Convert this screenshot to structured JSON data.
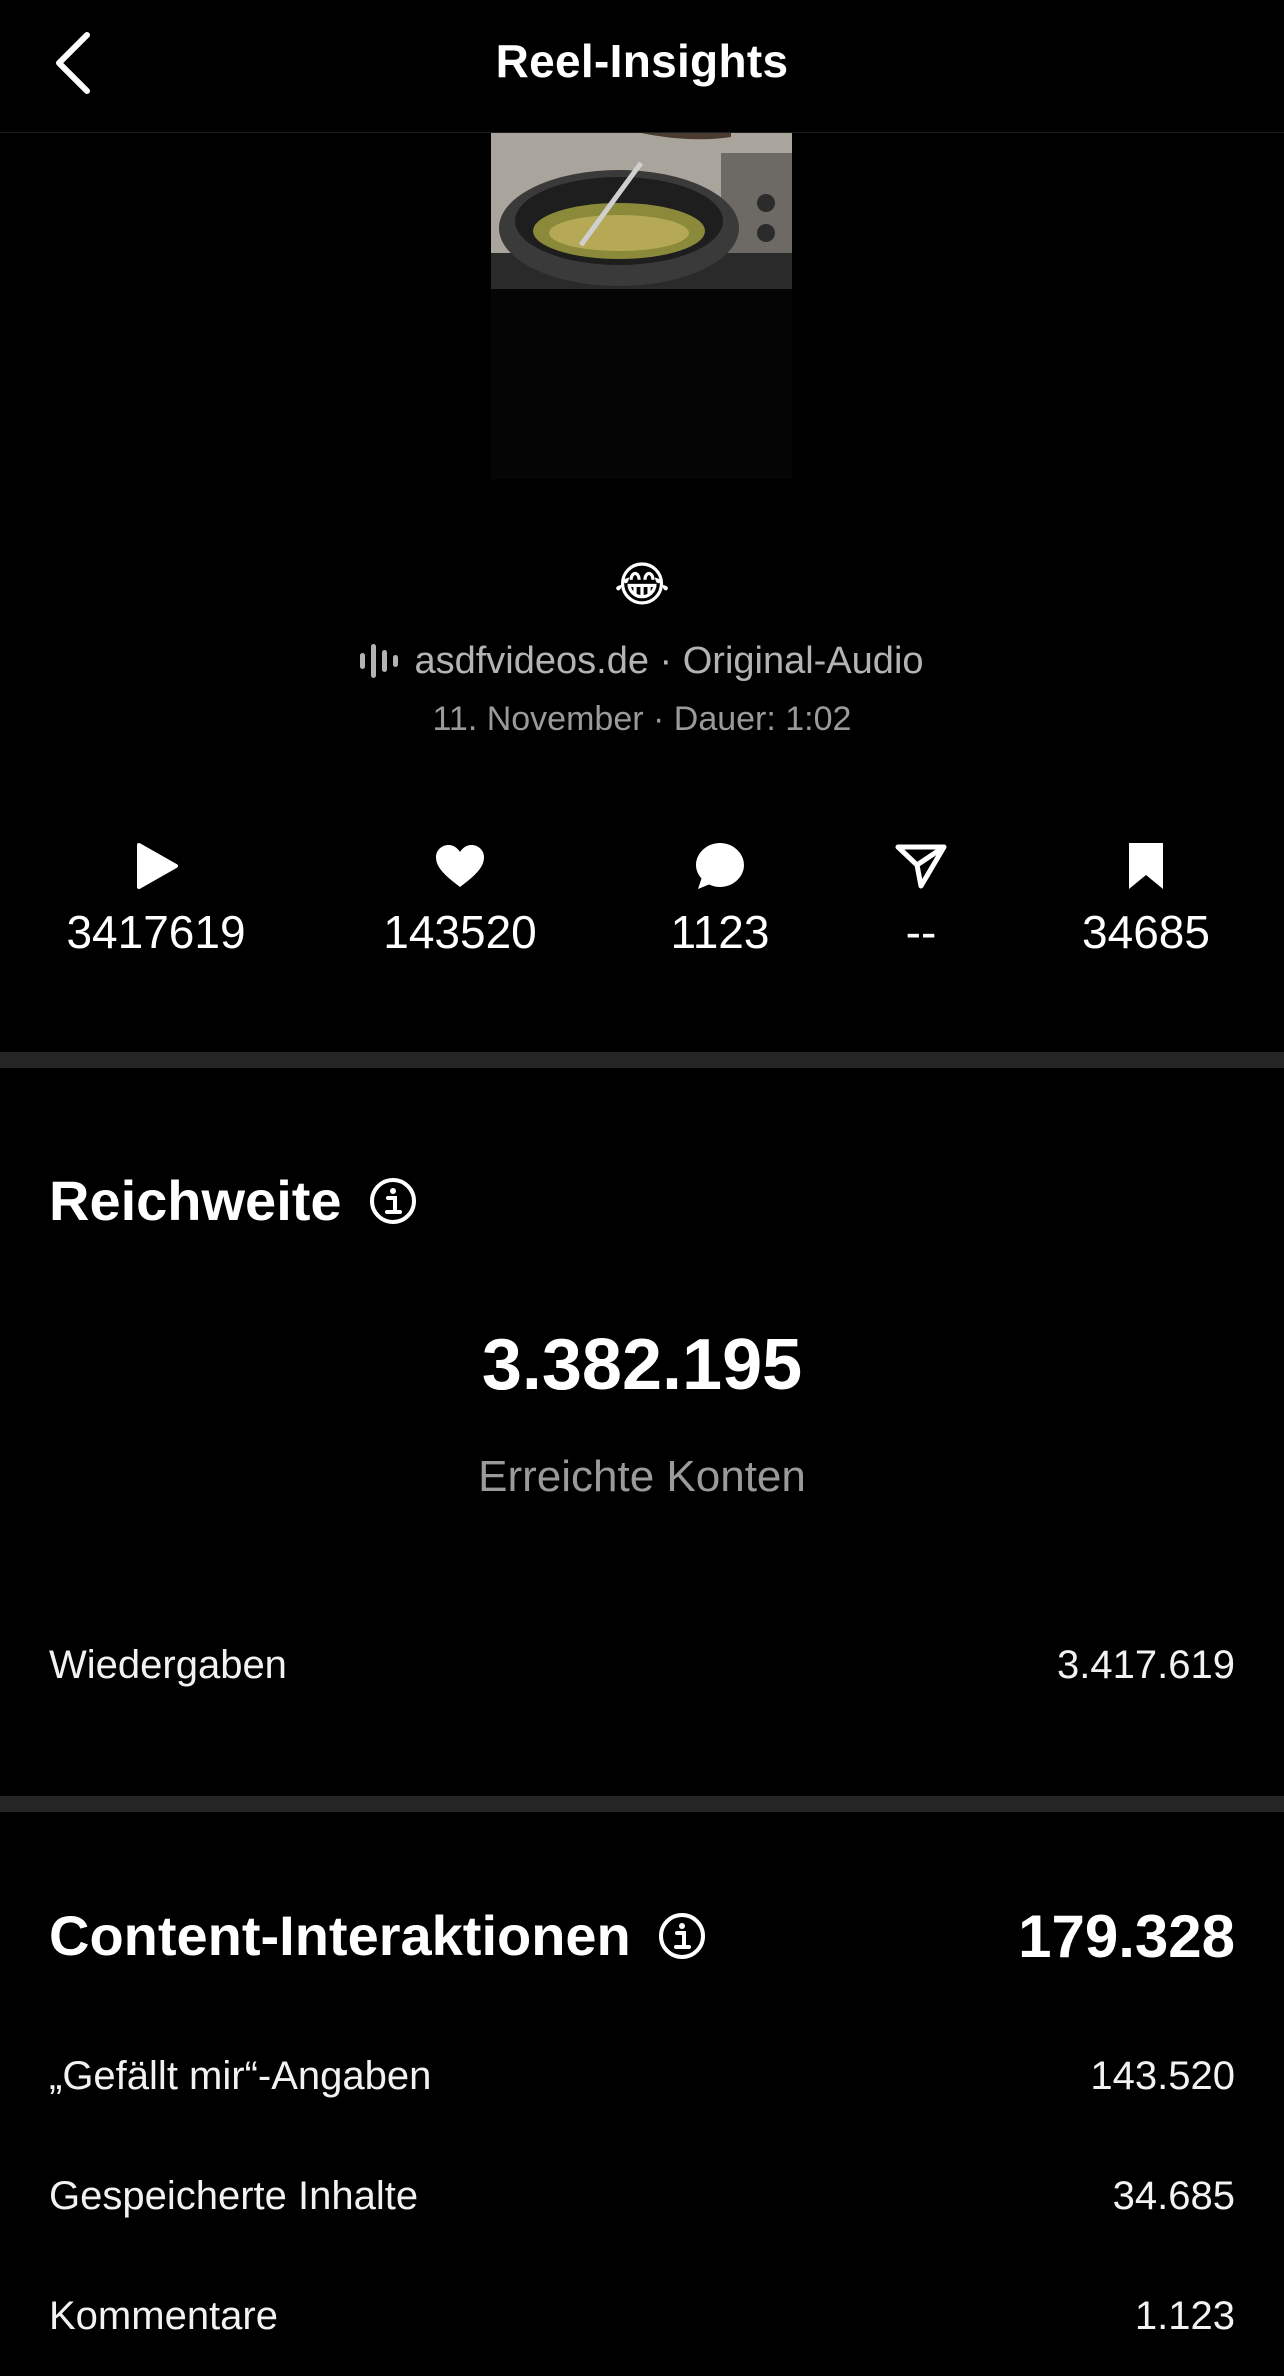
{
  "header": {
    "title": "Reel-Insights"
  },
  "post": {
    "emoji": "😂",
    "audio": "asdfvideos.de · Original-Audio",
    "meta": "11. November · Dauer: 1:02"
  },
  "stats": [
    {
      "icon": "play-icon",
      "value": "3417619"
    },
    {
      "icon": "heart-icon",
      "value": "143520"
    },
    {
      "icon": "comment-icon",
      "value": "1123"
    },
    {
      "icon": "share-icon",
      "value": "--"
    },
    {
      "icon": "bookmark-icon",
      "value": "34685"
    }
  ],
  "reach": {
    "title": "Reichweite",
    "accounts_value": "3.382.195",
    "accounts_label": "Erreichte Konten",
    "plays_label": "Wiedergaben",
    "plays_value": "3.417.619"
  },
  "interactions": {
    "title": "Content-Interaktionen",
    "total": "179.328",
    "rows": [
      {
        "label": "„Gefällt mir“-Angaben",
        "value": "143.520"
      },
      {
        "label": "Gespeicherte Inhalte",
        "value": "34.685"
      },
      {
        "label": "Kommentare",
        "value": "1.123"
      }
    ]
  }
}
